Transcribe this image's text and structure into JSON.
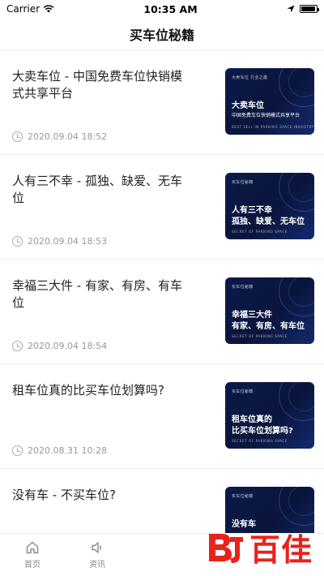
{
  "status_bar": {
    "carrier": "Carrier",
    "time": "10:35 AM",
    "battery_level": 0.95
  },
  "nav": {
    "title": "买车位秘籍"
  },
  "articles": [
    {
      "title": "大卖车位 - 中国免费车位快销模式共享平台",
      "date": "2020.09.04 18:52",
      "thumb_tag": "大卖车位 行业之最",
      "thumb_main": "大卖车位",
      "thumb_sub": "中国免费车位快销模式共享平台",
      "thumb_foot": "BEST SELL IN PARKING SPACE INDUSTRY"
    },
    {
      "title": "人有三不幸 - 孤独、缺爱、无车位",
      "date": "2020.09.04 18:53",
      "thumb_tag": "买车位秘籍",
      "thumb_main": "人有三不幸\n孤独、缺爱、无车位",
      "thumb_sub": "",
      "thumb_foot": "SECRET OF PARKING SPACE"
    },
    {
      "title": "幸福三大件 - 有家、有房、有车位",
      "date": "2020.09.04 18:54",
      "thumb_tag": "买车位秘籍",
      "thumb_main": "幸福三大件\n有家、有房、有车位",
      "thumb_sub": "",
      "thumb_foot": "SECRET OF PARKING SPACE"
    },
    {
      "title": "租车位真的比买车位划算吗?",
      "date": "2020.08.31 10:28",
      "thumb_tag": "买车位秘籍",
      "thumb_main": "租车位真的\n比买车位划算吗?",
      "thumb_sub": "",
      "thumb_foot": "SECRET OF PARKING SPACE"
    },
    {
      "title": "没有车 - 不买车位?",
      "date": "",
      "thumb_tag": "买车位秘籍",
      "thumb_main": "没有车",
      "thumb_sub": "",
      "thumb_foot": ""
    }
  ],
  "tabs": [
    {
      "label": "首页",
      "icon": "home-icon"
    },
    {
      "label": "资讯",
      "icon": "speaker-icon"
    }
  ],
  "watermark": {
    "text": "百佳",
    "color": "#e8231b"
  },
  "colors": {
    "thumb_bg": "#0b1a4a",
    "watermark_red": "#e8231b"
  }
}
